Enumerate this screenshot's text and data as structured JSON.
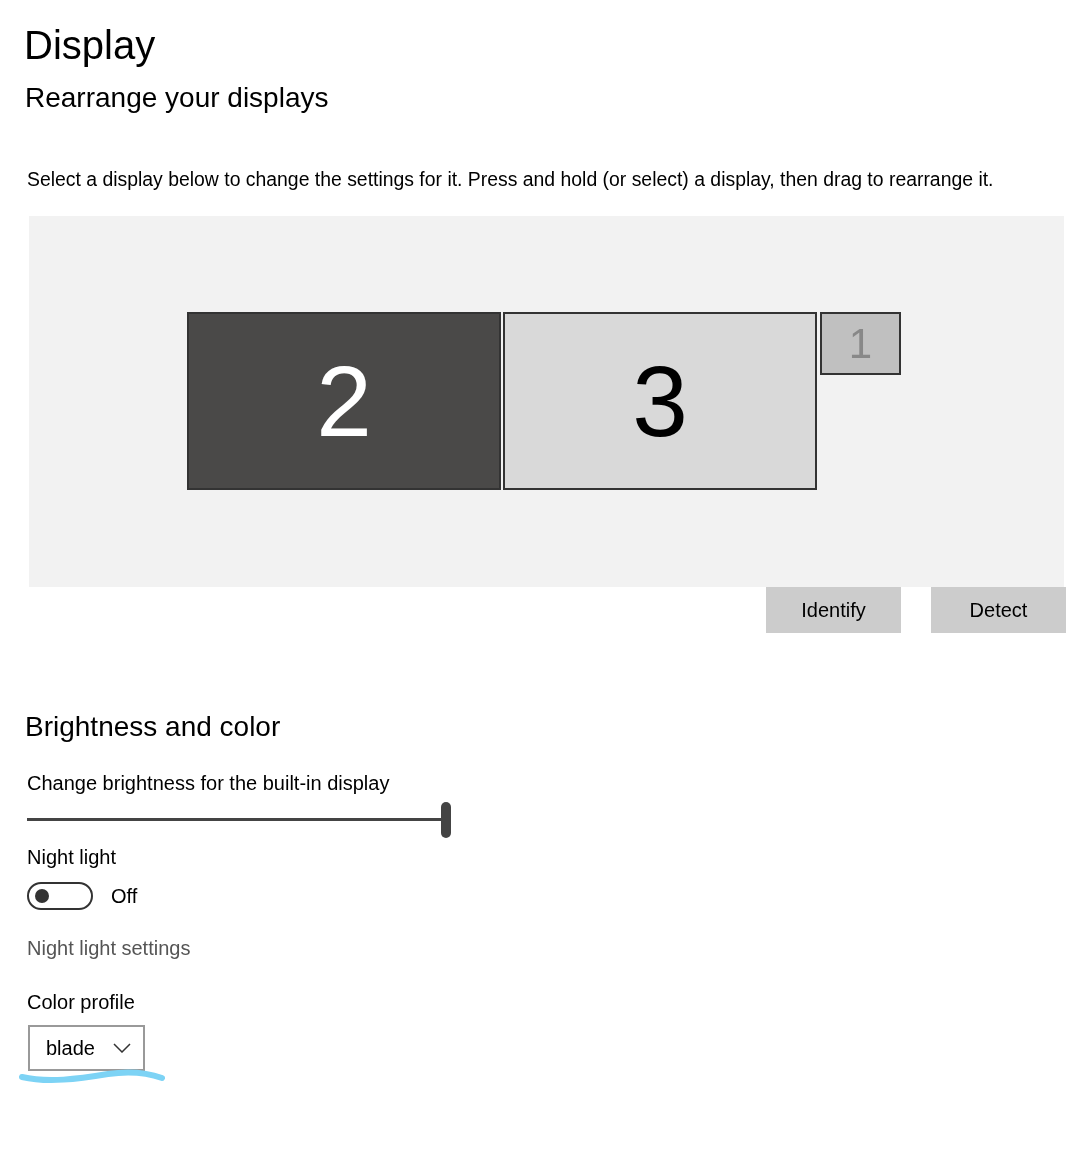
{
  "title": "Display",
  "arrangement": {
    "heading": "Rearrange your displays",
    "description": "Select a display below to change the settings for it. Press and hold (or select) a display, then drag to rearrange it.",
    "displays": [
      {
        "number": "2",
        "selected": true,
        "active": true
      },
      {
        "number": "3",
        "selected": false,
        "active": true
      },
      {
        "number": "1",
        "selected": false,
        "active": false
      }
    ],
    "buttons": [
      "Identify",
      "Detect"
    ]
  },
  "brightness": {
    "heading": "Brightness and color",
    "slider_label": "Change brightness for the built-in display",
    "level": 1.0,
    "night_light": {
      "label": "Night light",
      "on": false,
      "state_text": "Off"
    },
    "night_light_link": "Night light settings",
    "color_profile": {
      "label": "Color profile",
      "value": "blade"
    }
  }
}
